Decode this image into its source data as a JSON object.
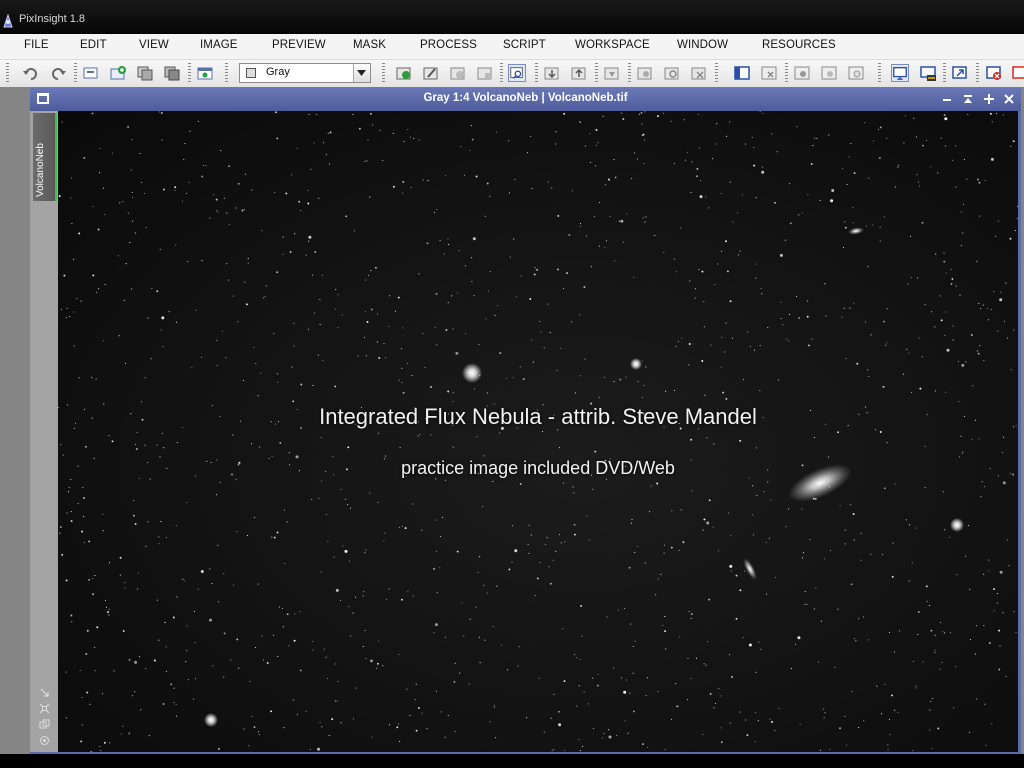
{
  "app": {
    "title": "PixInsight 1.8"
  },
  "menu": [
    "FILE",
    "EDIT",
    "VIEW",
    "IMAGE",
    "PREVIEW",
    "MASK",
    "PROCESS",
    "SCRIPT",
    "WORKSPACE",
    "WINDOW",
    "RESOURCES"
  ],
  "toolbar": {
    "color_space_value": "Gray",
    "icons": [
      "undo-icon",
      "redo-icon",
      "new-image-icon",
      "open-icon",
      "duplicate-icon",
      "image-properties-icon",
      "new-preview-icon",
      "screen-transfer-icon",
      "preview-add-icon",
      "preview-edit-icon",
      "preview-mode-icon",
      "preview-reset-icon",
      "zoom-preview-icon",
      "mask-enable-icon",
      "mask-show-icon",
      "mask-invert-icon",
      "process-run-icon",
      "process-history-icon",
      "process-reset-icon",
      "process-apply-icon",
      "layout-icon",
      "window-close-icon",
      "shadow-icon",
      "midtones-icon",
      "highlights-icon",
      "display-icon",
      "display-3d-icon",
      "tile-icon",
      "cascade-icon",
      "close-all-icon"
    ]
  },
  "image_window": {
    "title": "Gray 1:4 VolcanoNeb | VolcanoNeb.tif",
    "view_tab_label": "VolcanoNeb"
  },
  "overlay": {
    "caption_main": "Integrated Flux Nebula - attrib. Steve Mandel",
    "caption_sub": "practice image included DVD/Web"
  },
  "colors": {
    "window_titlebar": "#5d6ba9",
    "active_tab_indicator": "#3fbf4f",
    "workspace_bg": "#858585"
  }
}
